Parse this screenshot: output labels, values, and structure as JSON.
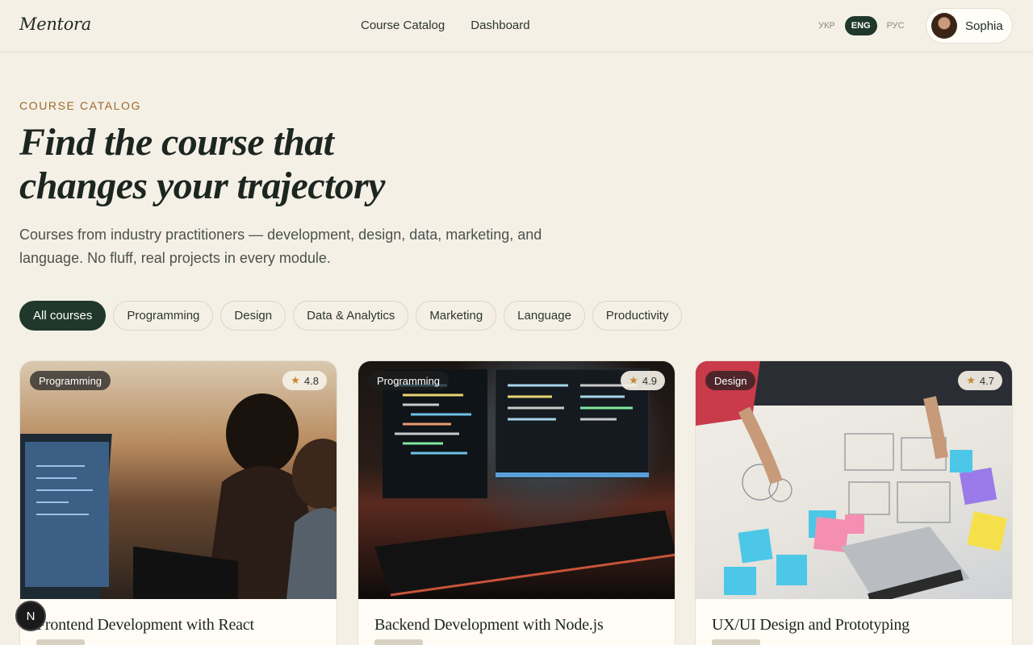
{
  "header": {
    "logo": "Mentora",
    "nav": [
      "Course Catalog",
      "Dashboard"
    ],
    "languages": [
      {
        "label": "УКР",
        "active": false
      },
      {
        "label": "ENG",
        "active": true
      },
      {
        "label": "РУС",
        "active": false
      }
    ],
    "user": {
      "name": "Sophia"
    }
  },
  "hero": {
    "eyebrow": "COURSE CATALOG",
    "title_line1": "Find the course that",
    "title_line2": "changes your trajectory",
    "subtitle": "Courses from industry practitioners — development, design, data, marketing, and language. No fluff, real projects in every module."
  },
  "filters": [
    {
      "label": "All courses",
      "active": true
    },
    {
      "label": "Programming",
      "active": false
    },
    {
      "label": "Design",
      "active": false
    },
    {
      "label": "Data & Analytics",
      "active": false
    },
    {
      "label": "Marketing",
      "active": false
    },
    {
      "label": "Language",
      "active": false
    },
    {
      "label": "Productivity",
      "active": false
    }
  ],
  "courses": [
    {
      "category": "Programming",
      "rating": "4.8",
      "title": "Frontend Development with React"
    },
    {
      "category": "Programming",
      "rating": "4.9",
      "title": "Backend Development with Node.js"
    },
    {
      "category": "Design",
      "rating": "4.7",
      "title": "UX/UI Design and Prototyping"
    }
  ],
  "fab_label": "N",
  "icons": {
    "star": "star-icon"
  },
  "colors": {
    "accent": "#20382c",
    "background": "#f5f0e6",
    "eyebrow": "#9a6a2c",
    "star": "#c8872e"
  }
}
